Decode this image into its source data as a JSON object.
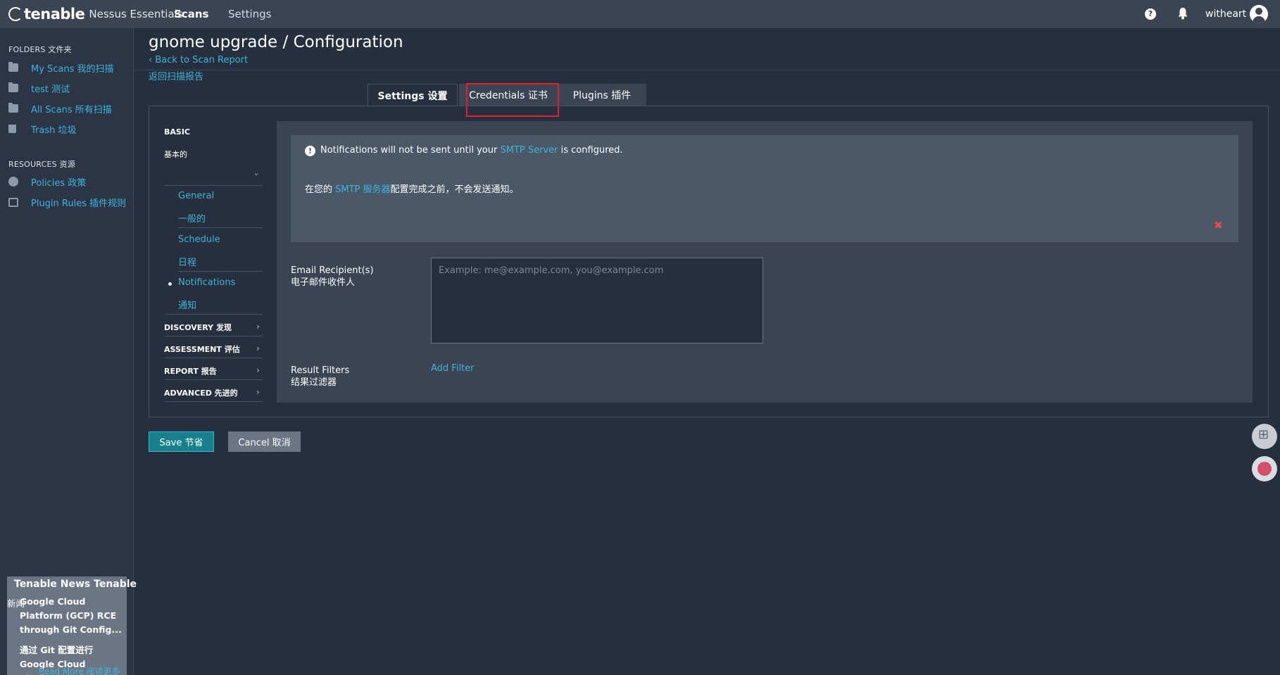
{
  "topbar": {
    "brand": "tenable",
    "product": "Nessus Essentials",
    "nav_scans": "Scans",
    "nav_settings": "Settings",
    "help_glyph": "?",
    "username": "witheart"
  },
  "sidebar": {
    "folders_label": "FOLDERS 文件夹",
    "folders": [
      {
        "label": "My Scans  我的扫描",
        "icon": "folder-icon"
      },
      {
        "label": "test  测试",
        "icon": "folder-icon"
      },
      {
        "label": "All Scans  所有扫描",
        "icon": "folder-icon"
      },
      {
        "label": "Trash  垃圾",
        "icon": "trash-icon"
      }
    ],
    "resources_label": "RESOURCES 资源",
    "resources": [
      {
        "label": "Policies  政策",
        "icon": "policy-icon"
      },
      {
        "label": "Plugin Rules  插件规则",
        "icon": "plugin-rules-icon"
      }
    ],
    "news": {
      "title": "Tenable News  Tenable",
      "xinwen": "新闻",
      "headline": "Google Cloud Platform (GCP) RCE through Git Config...",
      "headline_cn": "通过 Git 配置进行 Google Cloud Platform (GCP) RCE...",
      "read_more": "Read More  阅读更多"
    },
    "collapse_glyph": "«"
  },
  "page": {
    "title": "gnome upgrade / Configuration",
    "back_link": "‹ Back to Scan Report",
    "back_link_cn": "返回扫描报告"
  },
  "tabs": [
    {
      "label": "Settings  设置"
    },
    {
      "label": "Credentials  证书"
    },
    {
      "label": "Plugins  插件"
    }
  ],
  "leftnav": {
    "basic": "BASIC",
    "basic_cn": "基本的",
    "items": [
      {
        "label": "General",
        "label_cn": "一般的"
      },
      {
        "label": "Schedule",
        "label_cn": "日程"
      },
      {
        "label": "Notifications",
        "label_cn": "通知"
      }
    ],
    "sections": [
      {
        "label": "DISCOVERY  发现"
      },
      {
        "label": "ASSESSMENT  评估"
      },
      {
        "label": "REPORT  报告"
      },
      {
        "label": "ADVANCED  先进的"
      }
    ]
  },
  "alert": {
    "text_before": "Notifications will not be sent until your ",
    "link": "SMTP Server",
    "text_after": " is configured.",
    "cn_before": "在您的 ",
    "cn_link": "SMTP 服务器",
    "cn_after": "配置完成之前，不会发送通知。",
    "close_glyph": "✖"
  },
  "form": {
    "email_label": "Email Recipient(s)",
    "email_label_cn": "电子邮件收件人",
    "email_placeholder": "Example: me@example.com, you@example.com",
    "email_value": "",
    "filters_label": "Result Filters",
    "filters_label_cn": "结果过滤器",
    "add_filter": "Add Filter"
  },
  "buttons": {
    "save": "Save  节省",
    "cancel": "Cancel  取消"
  },
  "colors": {
    "accent": "#3fb4d9",
    "save_button": "#16818c",
    "highlight_box": "#e0232b",
    "close_x": "#e84c4c"
  }
}
